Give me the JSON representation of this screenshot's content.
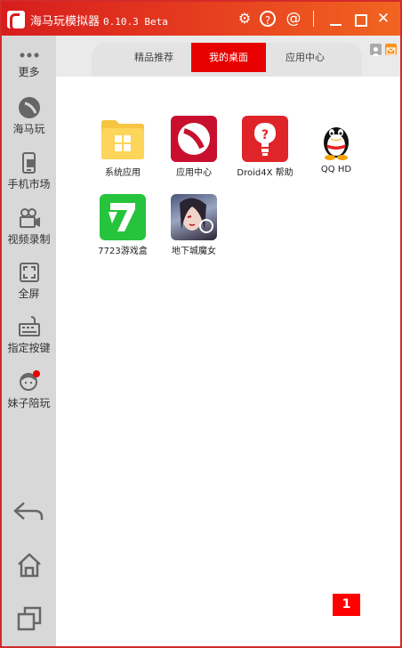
{
  "window": {
    "title": "海马玩模拟器",
    "version": "0.10.3 Beta",
    "buttons": {
      "settings_icon": "⚙",
      "help_icon": "?",
      "account_icon": "@",
      "close_icon": "✕"
    }
  },
  "sidebar": {
    "items": [
      {
        "label": "更多",
        "icon": "more-icon"
      },
      {
        "label": "海马玩",
        "icon": "haima-icon"
      },
      {
        "label": "手机市场",
        "icon": "phone-market-icon"
      },
      {
        "label": "视频录制",
        "icon": "video-record-icon"
      },
      {
        "label": "全屏",
        "icon": "fullscreen-icon"
      },
      {
        "label": "指定按键",
        "icon": "keyboard-icon"
      },
      {
        "label": "妹子陪玩",
        "icon": "girl-companion-icon"
      }
    ],
    "nav": [
      "back-icon",
      "home-icon",
      "recent-apps-icon"
    ]
  },
  "tabs": [
    {
      "label": "精品推荐"
    },
    {
      "label": "我的桌面",
      "active": true
    },
    {
      "label": "应用中心"
    }
  ],
  "apps": [
    {
      "label": "系统应用",
      "icon": "folder-icon"
    },
    {
      "label": "应用中心",
      "icon": "app-center-icon"
    },
    {
      "label": "Droid4X 帮助",
      "icon": "help-icon"
    },
    {
      "label": "QQ HD",
      "icon": "qq-icon"
    },
    {
      "label": "7723游戏盒",
      "icon": "7723-icon"
    },
    {
      "label": "地下城魔女",
      "icon": "game-witch-icon"
    }
  ],
  "page_indicator": "1",
  "colors": {
    "accent": "#e80000",
    "titlebar_start": "#d71d1d",
    "titlebar_end": "#f16520",
    "sidebar_bg": "#d8d8d8"
  }
}
